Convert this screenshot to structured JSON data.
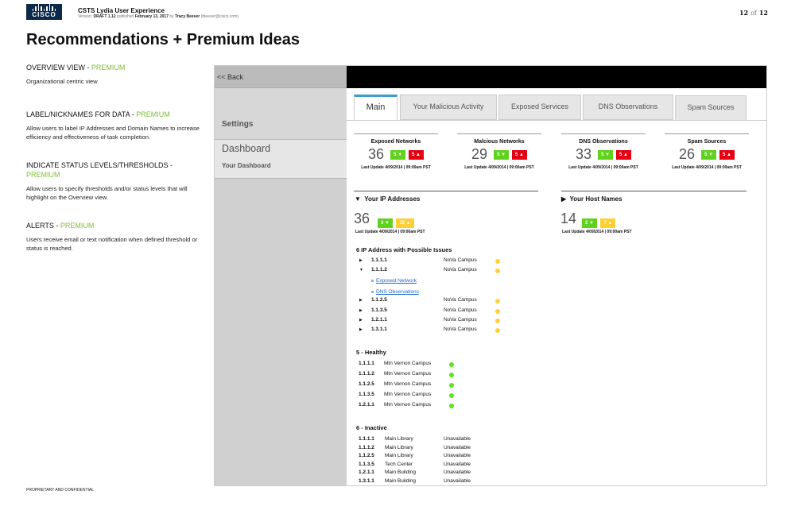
{
  "doc": {
    "logo_text": "CISCO",
    "title": "CSTS Lydia User Experience",
    "meta_version_label": "Version:",
    "meta_version": "DRAFT 1.12",
    "meta_published_label": "published",
    "meta_date": "February 13, 2017",
    "meta_by": "by",
    "meta_author": "Tracy Beeser",
    "meta_email": "(tbeeser@cisco.com)",
    "page_current": "12",
    "page_of": "of",
    "page_total": "12",
    "footer": "PROPRIETARY AND CONFIDENTIAL",
    "heading": "Recommendations + Premium Ideas"
  },
  "notes": [
    {
      "title": "OVERVIEW VIEW - ",
      "premium": "PREMIUM",
      "text": "Organizational centric view"
    },
    {
      "title": "LABEL/NICKNAMES FOR DATA - ",
      "premium": "PREMIUM",
      "text": "Allow users to label IP Addresses and Domain Names to increase efficiency and effectiveness of task completion."
    },
    {
      "title": "INDICATE STATUS LEVELS/THRESHOLDS - ",
      "premium": "PREMIUM",
      "text": "Allow users to specify thresholds and/or status levels that will highlight on the Overview view."
    },
    {
      "title": "ALERTS - ",
      "premium": "PREMIUM",
      "text": "Users receive email or text notification when defined threshold or status is reached."
    }
  ],
  "sidebar": {
    "back": "<< Back",
    "settings": "Settings",
    "dashboard": "Dashboard",
    "your_dashboard": "Your Dashboard"
  },
  "tabs": [
    "Main",
    "Your Malicious Activity",
    "Exposed Services",
    "DNS Observations",
    "Spam Sources"
  ],
  "stats": [
    {
      "name": "Exposed Networks",
      "value": "36",
      "green": "5",
      "red": "5",
      "update": "Last Update 4/09/2014 | 09:00am PST"
    },
    {
      "name": "Malcious Networks",
      "value": "29",
      "green": "5",
      "red": "5",
      "update": "Last Update 4/09/2014 | 09:00am PST"
    },
    {
      "name": "DNS Observations",
      "value": "33",
      "green": "5",
      "red": "5",
      "update": "Last Update 4/09/2014 | 09:00am PST"
    },
    {
      "name": "Spam Sources",
      "value": "26",
      "green": "5",
      "red": "5",
      "update": "Last Update 4/09/2014 | 09:00am PST"
    }
  ],
  "ip_section": {
    "title": "Your IP Addresses",
    "value": "36",
    "green": "3",
    "yellow": "15",
    "update": "Last Update 4/09/2014 | 09:00am PST"
  },
  "host_section": {
    "title": "Your Host Names",
    "value": "14",
    "green": "2",
    "yellow": "7",
    "update": "Last Update 4/09/2014 | 09:00am PST"
  },
  "issues": {
    "title": "6 IP Address with Possible Issues",
    "rows": [
      {
        "ip": "1.1.1.1",
        "loc": "NoVa Campus",
        "status": "yellow",
        "expanded": false
      },
      {
        "ip": "1.1.1.2",
        "loc": "NoVa Campus",
        "status": "yellow",
        "expanded": true
      },
      {
        "ip": "1.1.2.5",
        "loc": "NoVa Campus",
        "status": "yellow",
        "expanded": false
      },
      {
        "ip": "1.1.3.5",
        "loc": "NoVa Campus",
        "status": "yellow",
        "expanded": false
      },
      {
        "ip": "1.2.1.1",
        "loc": "NoVa Campus",
        "status": "yellow",
        "expanded": false
      },
      {
        "ip": "1.3.1.1",
        "loc": "NoVa Campus",
        "status": "yellow",
        "expanded": false
      }
    ],
    "links": [
      "Exposed Network",
      "DNS Observations"
    ]
  },
  "healthy": {
    "title": "5 - Healthy",
    "rows": [
      {
        "ip": "1.1.1.1",
        "loc": "Mtn Vernon Campus",
        "status": "green"
      },
      {
        "ip": "1.1.1.2",
        "loc": "Mtn Vernon Campus",
        "status": "green"
      },
      {
        "ip": "1.1.2.5",
        "loc": "Mtn Vernon Campus",
        "status": "green"
      },
      {
        "ip": "1.1.3.5",
        "loc": "Mtn Vernon Campus",
        "status": "green"
      },
      {
        "ip": "1.2.1.1",
        "loc": "Mtn Vernon Campus",
        "status": "green"
      }
    ]
  },
  "inactive": {
    "title": "6 - Inactive",
    "rows": [
      {
        "ip": "1.1.1.1",
        "loc": "Main Library",
        "status": "Unavailable"
      },
      {
        "ip": "1.1.1.2",
        "loc": "Main Library",
        "status": "Unavailable"
      },
      {
        "ip": "1.1.2.5",
        "loc": "Main Library",
        "status": "Unavailable"
      },
      {
        "ip": "1.1.3.5",
        "loc": "Tech Center",
        "status": "Unavailable"
      },
      {
        "ip": "1.2.1.1",
        "loc": "Main Building",
        "status": "Unavailable"
      },
      {
        "ip": "1.3.1.1",
        "loc": "Main Building",
        "status": "Unavailable"
      }
    ]
  },
  "icons": {
    "logo": "cisco-logo",
    "expand": "triangle-right-icon",
    "collapse": "triangle-down-icon",
    "link_bullet": "square-bullet-icon"
  },
  "colors": {
    "premium": "#7fbd39",
    "tab_active": "#3d9dd1",
    "badge_green": "#60d21e",
    "badge_red": "#e40012",
    "badge_yellow": "#ffcf33",
    "dot_green": "#5de21e",
    "dot_yellow": "#ffd23c",
    "link": "#1b6bcc"
  }
}
